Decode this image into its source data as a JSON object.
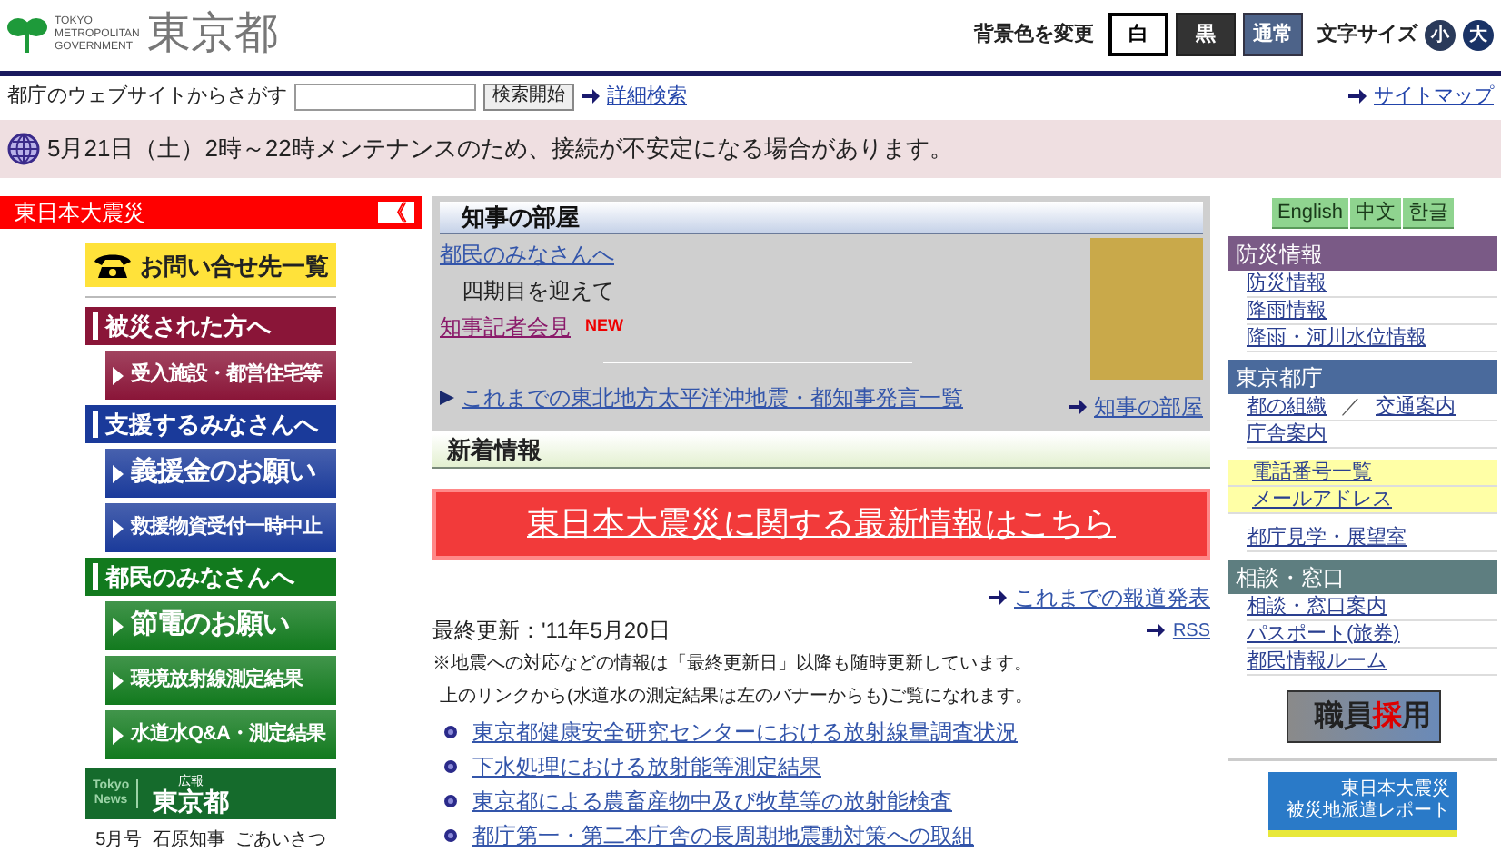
{
  "header": {
    "logo_small": [
      "TOKYO",
      "METROPOLITAN",
      "GOVERNMENT"
    ],
    "logo_title": "東京都",
    "bg_label": "背景色を変更",
    "bg_buttons": [
      {
        "label": "白",
        "kind": "white"
      },
      {
        "label": "黒",
        "kind": "black"
      },
      {
        "label": "通常",
        "kind": "normal"
      }
    ],
    "size_label": "文字サイズ",
    "size_buttons": [
      "小",
      "大"
    ]
  },
  "search": {
    "label": "都庁のウェブサイトからさがす",
    "button": "検索開始",
    "advanced": "詳細検索",
    "sitemap": "サイトマップ"
  },
  "notice": "5月21日（土）2時～22時メンテナンスのため、接続が不安定になる場合があります。",
  "left": {
    "title": "東日本大震災",
    "toggle": "《",
    "contact": "お問い合せ先一覧",
    "sections": [
      {
        "title": "被災された方へ",
        "color": "#8a1538",
        "items": [
          "受入施設・都営住宅等"
        ]
      },
      {
        "title": "支援するみなさんへ",
        "color": "#1a3a9a",
        "items": [
          "義援金のお願い",
          "救援物資受付一時中止"
        ]
      },
      {
        "title": "都民のみなさんへ",
        "color": "#127a1e",
        "items": [
          "節電のお願い",
          "環境放射線測定結果",
          "水道水Q&A・測定結果"
        ]
      }
    ],
    "news": {
      "tag": [
        "Tokyo",
        "News"
      ],
      "sub": "広報",
      "title": "東京都"
    },
    "caption": "5月号  石原知事  ごあいさつ"
  },
  "governor": {
    "title": "知事の部屋",
    "link1": "都民のみなさんへ",
    "sub": "四期目を迎えて",
    "link2": "知事記者会見",
    "badge": "NEW",
    "list_link": "これまでの東北地方太平洋沖地震・都知事発言一覧",
    "more": "知事の部屋"
  },
  "news": {
    "title": "新着情報",
    "banner": "東日本大震災に関する最新情報はこちら",
    "archive": "これまでの報道発表",
    "updated": "最終更新：'11年5月20日",
    "rss": "RSS",
    "note1": "※地震への対応などの情報は「最終更新日」以降も随時更新しています。",
    "note2": "上のリンクから(水道水の測定結果は左のバナーからも)ご覧になれます。",
    "items": [
      "東京都健康安全研究センターにおける放射線量調査状況",
      "下水処理における放射能等測定結果",
      "東京都による農畜産物中及び牧草等の放射能検査",
      "都庁第一・第二本庁舎の長周期地震動対策への取組"
    ]
  },
  "right": {
    "languages": [
      "English",
      "中文",
      "한글"
    ],
    "groups": [
      {
        "title": "防災情報",
        "color": "#7a5a86",
        "rows": [
          {
            "kind": "plain",
            "links": [
              "防災情報"
            ]
          },
          {
            "kind": "plain",
            "links": [
              "降雨情報"
            ]
          },
          {
            "kind": "plain",
            "links": [
              "降雨・河川水位情報"
            ]
          }
        ]
      },
      {
        "title": "東京都庁",
        "color": "#4a6a9c",
        "rows": [
          {
            "kind": "plain",
            "links": [
              "都の組織",
              "交通案内"
            ],
            "sep": "／"
          },
          {
            "kind": "plain",
            "links": [
              "庁舎案内"
            ]
          },
          {
            "kind": "highlight",
            "links": [
              "電話番号一覧"
            ]
          },
          {
            "kind": "highlight",
            "links": [
              "メールアドレス"
            ]
          },
          {
            "kind": "plain",
            "links": [
              "都庁見学・展望室"
            ]
          }
        ]
      },
      {
        "title": "相談・窓口",
        "color": "#5e7e80",
        "rows": [
          {
            "kind": "plain",
            "links": [
              "相談・窓口案内"
            ]
          },
          {
            "kind": "plain",
            "links": [
              "パスポート(旅券)"
            ]
          },
          {
            "kind": "plain",
            "links": [
              "都民情報ルーム"
            ]
          }
        ]
      }
    ],
    "recruit": {
      "text1": "職員",
      "text2": "採",
      "text3": "用"
    },
    "report": [
      "東日本大震災",
      "被災地派遣レポート"
    ]
  }
}
